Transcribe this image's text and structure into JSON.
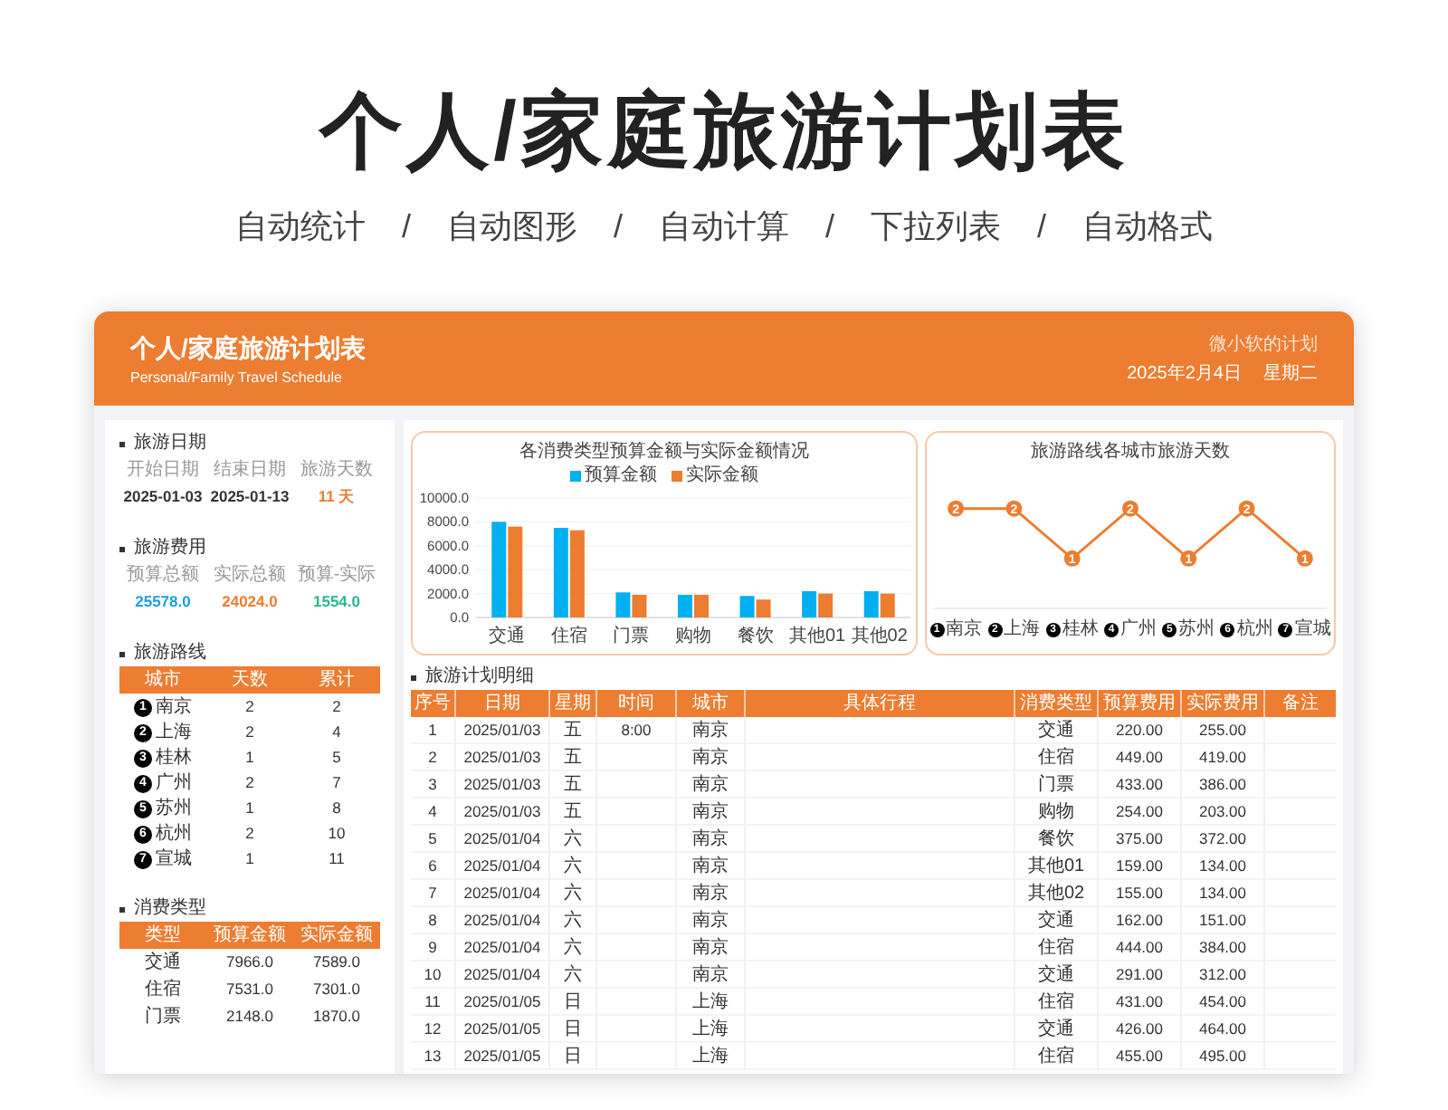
{
  "page": {
    "title": "个人/家庭旅游计划表",
    "features": [
      "自动统计",
      "自动图形",
      "自动计算",
      "下拉列表",
      "自动格式"
    ],
    "separators": [
      "/",
      "/",
      "/",
      "/"
    ]
  },
  "header": {
    "title": "个人/家庭旅游计划表",
    "subtitle": "Personal/Family Travel Schedule",
    "author": "微小软的计划",
    "date": "2025年2月4日",
    "weekday": "星期二"
  },
  "trip_dates": {
    "heading": "旅游日期",
    "items": [
      {
        "label": "开始日期",
        "value": "2025-01-03",
        "color": "#333333"
      },
      {
        "label": "结束日期",
        "value": "2025-01-13",
        "color": "#333333"
      },
      {
        "label": "旅游天数",
        "value": "11 天",
        "color": "#ed7d31"
      }
    ]
  },
  "trip_costs": {
    "heading": "旅游费用",
    "items": [
      {
        "label": "预算总额",
        "value": "25578.0",
        "color": "#1ba1e2"
      },
      {
        "label": "实际总额",
        "value": "24024.0",
        "color": "#ed7d31"
      },
      {
        "label": "预算-实际",
        "value": "1554.0",
        "color": "#2ab88e"
      }
    ]
  },
  "route": {
    "heading": "旅游路线",
    "columns": [
      "城市",
      "天数",
      "累计"
    ],
    "rows": [
      {
        "no": "1",
        "city": "南京",
        "days": "2",
        "total": "2"
      },
      {
        "no": "2",
        "city": "上海",
        "days": "2",
        "total": "4"
      },
      {
        "no": "3",
        "city": "桂林",
        "days": "1",
        "total": "5"
      },
      {
        "no": "4",
        "city": "广州",
        "days": "2",
        "total": "7"
      },
      {
        "no": "5",
        "city": "苏州",
        "days": "1",
        "total": "8"
      },
      {
        "no": "6",
        "city": "杭州",
        "days": "2",
        "total": "10"
      },
      {
        "no": "7",
        "city": "宣城",
        "days": "1",
        "total": "11"
      }
    ]
  },
  "expense_types": {
    "heading": "消费类型",
    "columns": [
      "类型",
      "预算金额",
      "实际金额"
    ],
    "rows": [
      [
        "交通",
        "7966.0",
        "7589.0"
      ],
      [
        "住宿",
        "7531.0",
        "7301.0"
      ],
      [
        "门票",
        "2148.0",
        "1870.0"
      ]
    ]
  },
  "bar_chart": {
    "chart_data": {
      "type": "bar",
      "title": "各消费类型预算金额与实际金额情况",
      "categories": [
        "交通",
        "住宿",
        "门票",
        "购物",
        "餐饮",
        "其他01",
        "其他02"
      ],
      "series": [
        {
          "name": "预算金额",
          "color": "#00b0f0",
          "values": [
            8000,
            7500,
            2100,
            1900,
            1800,
            2200,
            2200
          ]
        },
        {
          "name": "实际金额",
          "color": "#ed7d31",
          "values": [
            7600,
            7300,
            1900,
            1900,
            1500,
            2000,
            2000
          ]
        }
      ],
      "grid": true,
      "legend": "top",
      "ylim": [
        0,
        10000
      ],
      "yticks": [
        {
          "value": 0,
          "label": "0.0"
        },
        {
          "value": 2000,
          "label": "2000.0"
        },
        {
          "value": 4000,
          "label": "4000.0"
        },
        {
          "value": 6000,
          "label": "6000.0"
        },
        {
          "value": 8000,
          "label": "8000.0"
        },
        {
          "value": 10000,
          "label": "10000.0"
        }
      ]
    }
  },
  "line_chart": {
    "category_markers": [
      "1",
      "2",
      "3",
      "4",
      "5",
      "6",
      "7"
    ],
    "chart_data": {
      "type": "line",
      "title": "旅游路线各城市旅游天数",
      "categories": [
        "南京",
        "上海",
        "桂林",
        "广州",
        "苏州",
        "杭州",
        "宣城"
      ],
      "series": [
        {
          "color": "#ed7d31",
          "marker": "circle",
          "values": [
            2,
            2,
            1,
            2,
            1,
            2,
            1
          ]
        }
      ],
      "data_labels": true
    }
  },
  "plan": {
    "heading": "旅游计划明细",
    "columns": [
      "序号",
      "日期",
      "星期",
      "时间",
      "城市",
      "具体行程",
      "消费类型",
      "预算费用",
      "实际费用",
      "备注"
    ],
    "rows": [
      {
        "no": "1",
        "date": "2025/01/03",
        "weekday": "五",
        "time": "8:00",
        "city": "南京",
        "type": "交通",
        "budget": "220.00",
        "actual": "255.00"
      },
      {
        "no": "2",
        "date": "2025/01/03",
        "weekday": "五",
        "city": "南京",
        "type": "住宿",
        "budget": "449.00",
        "actual": "419.00"
      },
      {
        "no": "3",
        "date": "2025/01/03",
        "weekday": "五",
        "city": "南京",
        "type": "门票",
        "budget": "433.00",
        "actual": "386.00"
      },
      {
        "no": "4",
        "date": "2025/01/03",
        "weekday": "五",
        "city": "南京",
        "type": "购物",
        "budget": "254.00",
        "actual": "203.00"
      },
      {
        "no": "5",
        "date": "2025/01/04",
        "weekday": "六",
        "city": "南京",
        "type": "餐饮",
        "budget": "375.00",
        "actual": "372.00"
      },
      {
        "no": "6",
        "date": "2025/01/04",
        "weekday": "六",
        "city": "南京",
        "type": "其他01",
        "budget": "159.00",
        "actual": "134.00"
      },
      {
        "no": "7",
        "date": "2025/01/04",
        "weekday": "六",
        "city": "南京",
        "type": "其他02",
        "budget": "155.00",
        "actual": "134.00"
      },
      {
        "no": "8",
        "date": "2025/01/04",
        "weekday": "六",
        "city": "南京",
        "type": "交通",
        "budget": "162.00",
        "actual": "151.00"
      },
      {
        "no": "9",
        "date": "2025/01/04",
        "weekday": "六",
        "city": "南京",
        "type": "住宿",
        "budget": "444.00",
        "actual": "384.00"
      },
      {
        "no": "10",
        "date": "2025/01/04",
        "weekday": "六",
        "city": "南京",
        "type": "交通",
        "budget": "291.00",
        "actual": "312.00"
      },
      {
        "no": "11",
        "date": "2025/01/05",
        "weekday": "日",
        "city": "上海",
        "type": "住宿",
        "budget": "431.00",
        "actual": "454.00"
      },
      {
        "no": "12",
        "date": "2025/01/05",
        "weekday": "日",
        "city": "上海",
        "type": "交通",
        "budget": "426.00",
        "actual": "464.00"
      },
      {
        "no": "13",
        "date": "2025/01/05",
        "weekday": "日",
        "city": "上海",
        "type": "住宿",
        "budget": "455.00",
        "actual": "495.00"
      }
    ]
  }
}
